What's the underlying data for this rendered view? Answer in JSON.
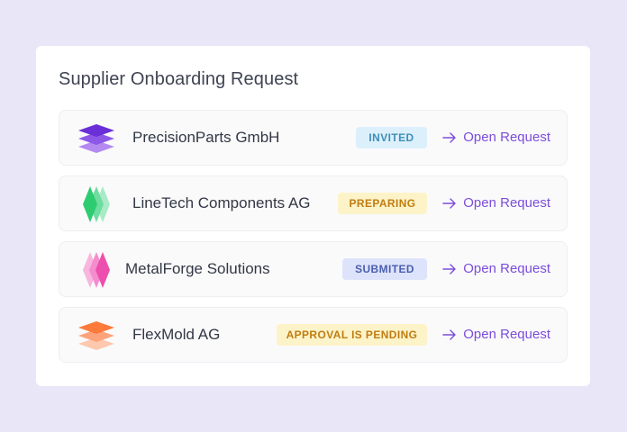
{
  "title": "Supplier Onboarding Request",
  "rows": [
    {
      "name": "PrecisionParts GmbH",
      "status": "INVITED",
      "action": "Open Request",
      "status_bg": "#dcf0fb",
      "status_fg": "#3e8fb8",
      "logo": "layered-stack-icon",
      "logo_colors": [
        "#6a2fd6",
        "#8d58e8",
        "#b48af0"
      ]
    },
    {
      "name": "LineTech Components AG",
      "status": "PREPARING",
      "action": "Open Request",
      "status_bg": "#fdf3c8",
      "status_fg": "#c07d12",
      "logo": "diamond-stack-icon",
      "logo_colors": [
        "#2ecc71",
        "#6fdca0",
        "#a9ebc6"
      ]
    },
    {
      "name": "MetalForge Solutions",
      "status": "SUBMITED",
      "action": "Open Request",
      "status_bg": "#dde3fb",
      "status_fg": "#4b5fb0",
      "logo": "diamond-stack-icon",
      "logo_colors": [
        "#f7b6de",
        "#f58ccd",
        "#ec4fae"
      ]
    },
    {
      "name": "FlexMold AG",
      "status": "APPROVAL IS PENDING",
      "action": "Open Request",
      "status_bg": "#fdf3c8",
      "status_fg": "#c07d12",
      "logo": "layered-stack-icon",
      "logo_colors": [
        "#fb7a3c",
        "#fca37b",
        "#fdc8ad"
      ]
    }
  ]
}
